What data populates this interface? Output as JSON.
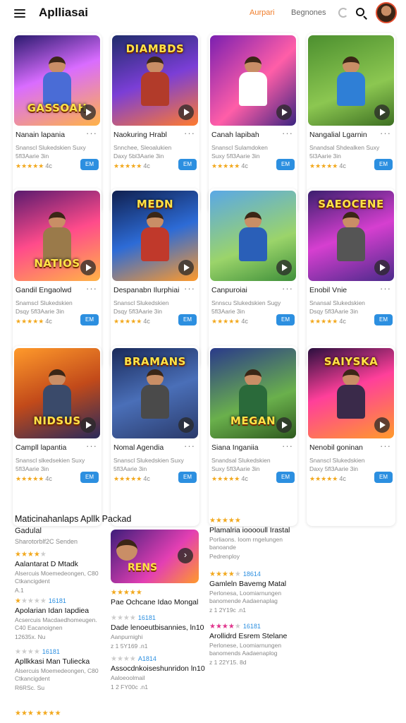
{
  "header": {
    "title": "Aplliasai",
    "tab_active": "Aurpari",
    "tab_other": "Begnones"
  },
  "colors": {
    "accent_orange": "#f07d2a",
    "badge_blue": "#2c8fe0",
    "star_gold": "#f2a81d",
    "star_pink": "#e0348c"
  },
  "cards": [
    {
      "art_title": "GASSOAH",
      "name": "Nanain lapania",
      "desc": "Snanscl Slukedskien Suxy 5fl3Aarie 3in",
      "stars": "★★★★★",
      "rating": "4c",
      "badge": "EM"
    },
    {
      "art_title": "DIAMBDS",
      "name": "Naokuring Hrabl",
      "desc": "Snnchee, Sleoalukien Daxy 5bl3Aarie 3in",
      "stars": "★★★★★",
      "rating": "4c",
      "badge": "EM"
    },
    {
      "art_title": "",
      "name": "Canah lapibah",
      "desc": "Snanscl Sulamdoken Suxy 5fl3Aarie 3in",
      "stars": "★★★★★",
      "rating": "4c",
      "badge": "EM"
    },
    {
      "art_title": "",
      "name": "Nangalial Lgarnin",
      "desc": "Snandsal Shdealken Suxy 5l3Aarie 3in",
      "stars": "★★★★★",
      "rating": "4c",
      "badge": "EM"
    },
    {
      "art_title": "NATIOS",
      "name": "Gandil Engaolwd",
      "desc": "Snamscl Slukedskien Dsqy 5fl3Aarie 3in",
      "stars": "★★★★★",
      "rating": "4c",
      "badge": "EM"
    },
    {
      "art_title": "MEDN",
      "name": "Despanabn Ilurphiai",
      "desc": "Snanscl Slukedskien Dsqy 5fl3Aarie 3in",
      "stars": "★★★★★",
      "rating": "4c",
      "badge": "EM"
    },
    {
      "art_title": "",
      "name": "Canpuroiai",
      "desc": "Snnscu Slukedskien Sugy 5fl3Aarie 3in",
      "stars": "★★★★★",
      "rating": "4c",
      "badge": "EM"
    },
    {
      "art_title": "SAEOCENE",
      "name": "Enobil Vnie",
      "desc": "Snansal Slukedskien Dsqy 5fl3Aarie 3in",
      "stars": "★★★★★",
      "rating": "4c",
      "badge": "EM"
    },
    {
      "art_title": "NIDSUS",
      "name": "Campll lapantia",
      "desc": "Snanscl slkedsekien Suxy 5fl3Aarie 3in",
      "stars": "★★★★★",
      "rating": "4c",
      "badge": "EM"
    },
    {
      "art_title": "BRAMANS",
      "name": "Nomal Agendia",
      "desc": "Snanscl Slukedskien Suxy 5fl3Aarie 3in",
      "stars": "★★★★★",
      "rating": "4c",
      "badge": "EM"
    },
    {
      "art_title": "MEGAN",
      "name": "Siana Inganiia",
      "desc": "Snandsal Slukedskien Suxy 5fl3Aarie 3in",
      "stars": "★★★★★",
      "rating": "4c",
      "badge": "EM"
    },
    {
      "art_title": "SAIYSKA",
      "name": "Nenobil goninan",
      "desc": "Snanscl Slukedskien Daxy 5fl3Aarie 3in",
      "stars": "★★★★★",
      "rating": "4c",
      "badge": "EM"
    }
  ],
  "section": {
    "title": "Maticinahanlaps Apllk Packad",
    "sub_title": "Gadulal",
    "sub_meta": "Sharotorblf2C Senden",
    "feature_title": "RENS"
  },
  "list_left": [
    {
      "stars": "★★★★",
      "grey": "★",
      "num": "",
      "name": "Aalantarat D Mtadk",
      "desc": "Alsercuis Moemedeongen, C80 Ctkancigdent",
      "foot": "A.1"
    },
    {
      "stars": "★",
      "grey": "★★★★",
      "num": "16181",
      "name": "Apolarian Idan Iapdiea",
      "desc": "Acsercuis Macdaedhomeugen. C40 Eacanoignen",
      "foot": "12635x. Nu"
    },
    {
      "stars": "",
      "grey": "★★★★",
      "num": "16181",
      "name": "Apllkkasi Man Tuliecka",
      "desc": "Alsercuis Moemedeongen, C80 Ctkancigdent",
      "foot": "R6RSc. Su"
    }
  ],
  "list_mid": [
    {
      "stars": "★★★★★",
      "grey": "",
      "num": "",
      "name": "Pae Ochcane Idao Mongal",
      "desc": "",
      "foot": ""
    },
    {
      "stars": "",
      "grey": "★★★★",
      "num": "16181",
      "name": "Dade lenoeutbisannies, ln10",
      "desc": "Aanpurnighi",
      "foot": "z 1 5Y169 .n1"
    },
    {
      "stars": "",
      "grey": "★★★★",
      "num": "A1814",
      "name": "Assocdnkoiseshunridon ln10",
      "desc": "Aaloeoolmail",
      "foot": "1 2 FY00c .n1"
    }
  ],
  "list_right": [
    {
      "stars": "★★★★★",
      "grey": "",
      "num": "",
      "name": "Plamalria iooooull Irastal",
      "desc": "Porliaons. Ioom rngelungen banoande",
      "foot": "Pedrenploy"
    },
    {
      "stars": "★★★★",
      "grey": "★",
      "num": "18614",
      "name": "Gamleln Bavemg Matal",
      "desc": "Perlonesa, Loomiarnungen banomende Aadaenaplag",
      "foot": "z 1 2Y19c .n1"
    },
    {
      "stars": "★★★★",
      "grey": "★",
      "num": "16181",
      "name": "Arollidrd Esrem Stelane",
      "desc": "Perlonese, Loomiarnungen banomends Aadaenaplog",
      "foot": "z 1 22Y15. 8d"
    }
  ],
  "bottom_stars": "★★★ ★★★★"
}
